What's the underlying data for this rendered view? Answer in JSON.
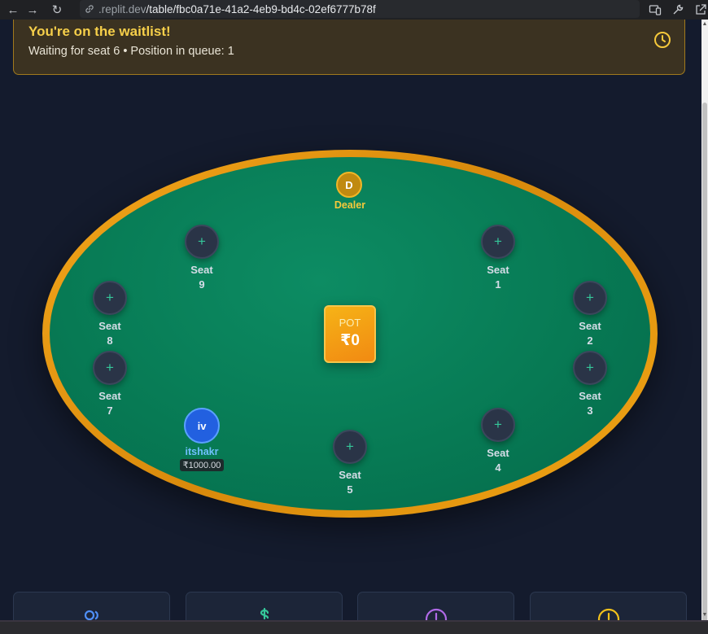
{
  "browser": {
    "url_host": ".replit.dev",
    "url_path": "/table/fbc0a71e-41a2-4eb9-bd4c-02ef6777b78f"
  },
  "waitlist": {
    "title": "You're on the waitlist!",
    "message": "Waiting for seat 6 • Position in queue: 1"
  },
  "dealer": {
    "chip": "D",
    "label": "Dealer"
  },
  "pot": {
    "label": "POT",
    "amount": "₹0"
  },
  "seats": [
    {
      "word": "Seat",
      "number": "1"
    },
    {
      "word": "Seat",
      "number": "2"
    },
    {
      "word": "Seat",
      "number": "3"
    },
    {
      "word": "Seat",
      "number": "4"
    },
    {
      "word": "Seat",
      "number": "5"
    },
    {
      "word": "Seat",
      "number": "7"
    },
    {
      "word": "Seat",
      "number": "8"
    },
    {
      "word": "Seat",
      "number": "9"
    }
  ],
  "seat_icon": "+",
  "player": {
    "initials": "iv",
    "name": "itshakr",
    "chips": "₹1000.00"
  },
  "colors": {
    "accent_gold": "#f6c93b",
    "felt_green": "#077a54",
    "empty_seat_plus": "#35c79a",
    "player_blue": "#2260e0"
  }
}
